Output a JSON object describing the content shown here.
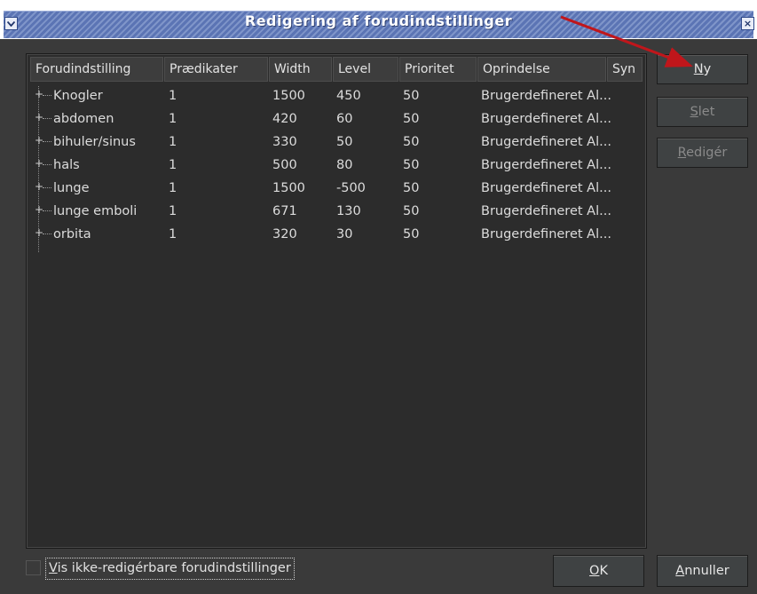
{
  "window": {
    "title": "Redigering af forudindstillinger",
    "menu_icon": "chevron-down-icon",
    "close_icon": "close-icon",
    "close_glyph": "×"
  },
  "table": {
    "headers": [
      "Forudindstilling",
      "Prædikater",
      "Width",
      "Level",
      "Prioritet",
      "Oprindelse",
      "Syn"
    ],
    "rows": [
      [
        "Knogler",
        "1",
        "1500",
        "450",
        "50",
        "Brugerdefineret Al..."
      ],
      [
        "abdomen",
        "1",
        "420",
        "60",
        "50",
        "Brugerdefineret Al..."
      ],
      [
        "bihuler/sinus",
        "1",
        "330",
        "50",
        "50",
        "Brugerdefineret Al..."
      ],
      [
        "hals",
        "1",
        "500",
        "80",
        "50",
        "Brugerdefineret Al..."
      ],
      [
        "lunge",
        "1",
        "1500",
        "-500",
        "50",
        "Brugerdefineret Al..."
      ],
      [
        "lunge emboli",
        "1",
        "671",
        "130",
        "50",
        "Brugerdefineret Al..."
      ],
      [
        "orbita",
        "1",
        "320",
        "30",
        "50",
        "Brugerdefineret Al..."
      ]
    ]
  },
  "buttons": {
    "new": {
      "mnemonic": "N",
      "rest": "y"
    },
    "delete": {
      "mnemonic": "S",
      "rest": "let"
    },
    "edit": {
      "mnemonic": "R",
      "rest": "edigér"
    },
    "ok": {
      "mnemonic": "O",
      "rest": "K"
    },
    "cancel": {
      "mnemonic": "A",
      "rest": "nnuller"
    }
  },
  "show_noneditable": {
    "mnemonic": "V",
    "rest": "is ikke-redigérbare forudindstillinger",
    "checked": false
  },
  "annotation": {
    "arrow_color": "#c0161b"
  }
}
